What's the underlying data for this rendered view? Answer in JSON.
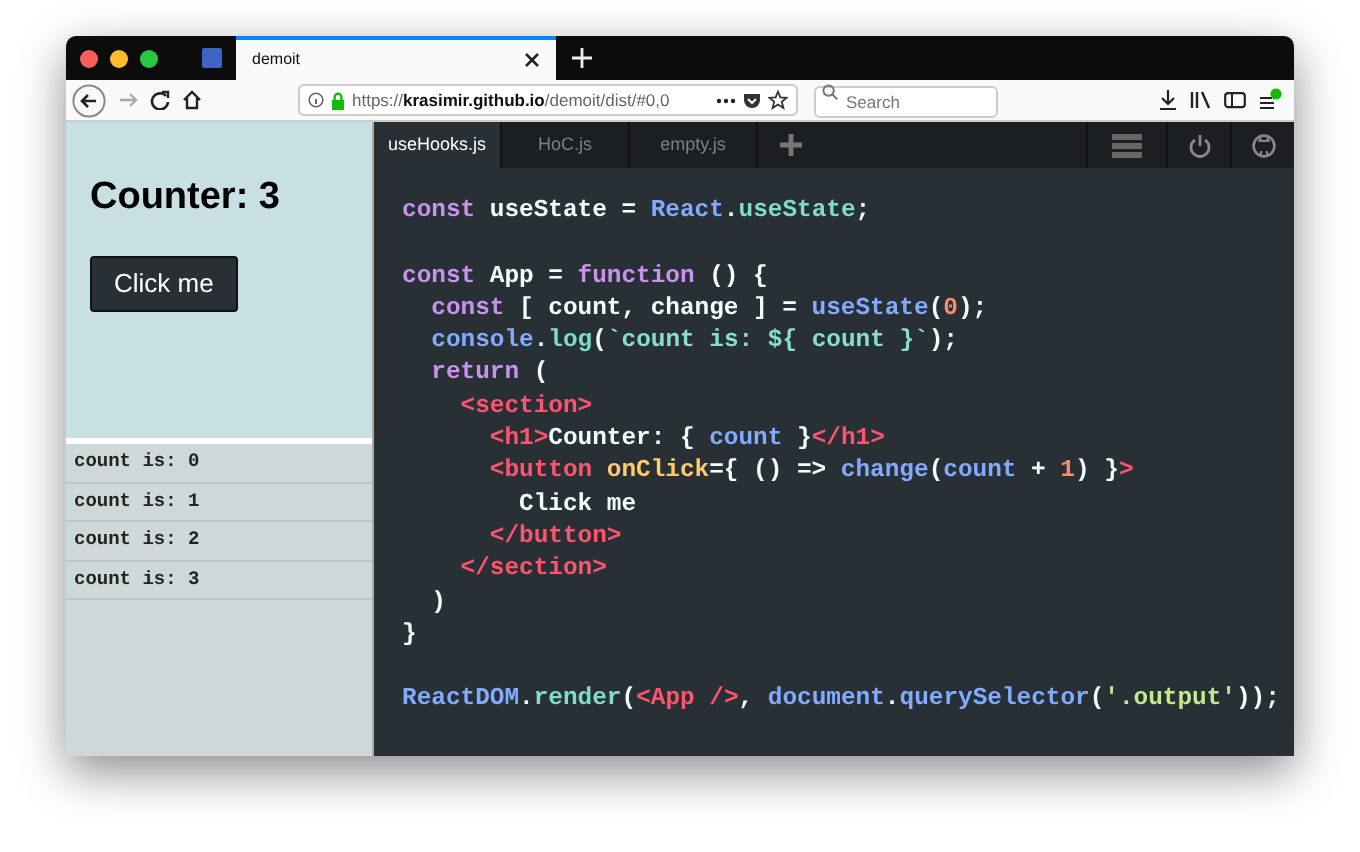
{
  "browser": {
    "tabs": [
      {
        "label": "demoit",
        "selected": true
      }
    ],
    "url_host": "krasimir.github.io",
    "url_scheme": "https://",
    "url_path": "/demoit/dist/#0,0",
    "search": {
      "placeholder": "Search"
    }
  },
  "output": {
    "heading": "Counter: 3",
    "button": "Click me",
    "log": [
      "count is: 0",
      "count is: 1",
      "count is: 2",
      "count is: 3"
    ]
  },
  "editor": {
    "tabs": [
      {
        "label": "useHooks.js",
        "selected": true
      },
      {
        "label": "HoC.js",
        "selected": false
      },
      {
        "label": "empty.js",
        "selected": false
      }
    ],
    "code": [
      {
        "kind": "code",
        "tokens": [
          {
            "text": "const",
            "kind": "kw"
          },
          {
            "text": " useState = ",
            "kind": "plain"
          },
          {
            "text": "React",
            "kind": "fn"
          },
          {
            "text": ".",
            "kind": "plain"
          },
          {
            "text": "useState",
            "kind": "prop"
          },
          {
            "text": ";",
            "kind": "plain"
          }
        ]
      },
      {
        "kind": "blank"
      },
      {
        "kind": "code",
        "tokens": [
          {
            "text": "const",
            "kind": "kw"
          },
          {
            "text": " App = ",
            "kind": "plain"
          },
          {
            "text": "function",
            "kind": "kw"
          },
          {
            "text": " () {",
            "kind": "plain"
          }
        ]
      },
      {
        "kind": "code",
        "tokens": [
          {
            "text": "  const",
            "kind": "kw"
          },
          {
            "text": " [ count, change ] = ",
            "kind": "plain"
          },
          {
            "text": "useState",
            "kind": "fn"
          },
          {
            "text": "(",
            "kind": "plain"
          },
          {
            "text": "0",
            "kind": "num"
          },
          {
            "text": ");",
            "kind": "plain"
          }
        ]
      },
      {
        "kind": "code",
        "tokens": [
          {
            "text": "  console",
            "kind": "fn"
          },
          {
            "text": ".",
            "kind": "plain"
          },
          {
            "text": "log",
            "kind": "prop"
          },
          {
            "text": "(",
            "kind": "plain"
          },
          {
            "text": "`count is: ${ count }`",
            "kind": "tpl"
          },
          {
            "text": ");",
            "kind": "plain"
          }
        ]
      },
      {
        "kind": "code",
        "tokens": [
          {
            "text": "  return",
            "kind": "kw"
          },
          {
            "text": " (",
            "kind": "plain"
          }
        ]
      },
      {
        "kind": "code",
        "tokens": [
          {
            "text": "    <section>",
            "kind": "tag"
          }
        ]
      },
      {
        "kind": "code",
        "tokens": [
          {
            "text": "      <h1>",
            "kind": "tag"
          },
          {
            "text": "Counter: { ",
            "kind": "plain"
          },
          {
            "text": "count",
            "kind": "fn"
          },
          {
            "text": " }",
            "kind": "plain"
          },
          {
            "text": "</h1>",
            "kind": "tag"
          }
        ]
      },
      {
        "kind": "code",
        "tokens": [
          {
            "text": "      <button",
            "kind": "tag"
          },
          {
            "text": " onClick",
            "kind": "attr"
          },
          {
            "text": "={ () => ",
            "kind": "plain"
          },
          {
            "text": "change",
            "kind": "fn"
          },
          {
            "text": "(",
            "kind": "plain"
          },
          {
            "text": "count",
            "kind": "fn"
          },
          {
            "text": " + ",
            "kind": "plain"
          },
          {
            "text": "1",
            "kind": "num"
          },
          {
            "text": ") }",
            "kind": "plain"
          },
          {
            "text": ">",
            "kind": "tag"
          }
        ]
      },
      {
        "kind": "code",
        "tokens": [
          {
            "text": "        Click me",
            "kind": "plain"
          }
        ]
      },
      {
        "kind": "code",
        "tokens": [
          {
            "text": "      </button>",
            "kind": "tag"
          }
        ]
      },
      {
        "kind": "code",
        "tokens": [
          {
            "text": "    </section>",
            "kind": "tag"
          }
        ]
      },
      {
        "kind": "code",
        "tokens": [
          {
            "text": "  )",
            "kind": "plain"
          }
        ]
      },
      {
        "kind": "code",
        "tokens": [
          {
            "text": "}",
            "kind": "plain"
          }
        ]
      },
      {
        "kind": "blank"
      },
      {
        "kind": "code",
        "tokens": [
          {
            "text": "ReactDOM",
            "kind": "fn"
          },
          {
            "text": ".",
            "kind": "plain"
          },
          {
            "text": "render",
            "kind": "prop"
          },
          {
            "text": "(",
            "kind": "plain"
          },
          {
            "text": "<App />",
            "kind": "tag"
          },
          {
            "text": ", ",
            "kind": "plain"
          },
          {
            "text": "document",
            "kind": "fn"
          },
          {
            "text": ".",
            "kind": "plain"
          },
          {
            "text": "querySelector",
            "kind": "fn"
          },
          {
            "text": "(",
            "kind": "plain"
          },
          {
            "text": "'.output'",
            "kind": "str"
          },
          {
            "text": "));",
            "kind": "plain"
          }
        ]
      }
    ]
  }
}
